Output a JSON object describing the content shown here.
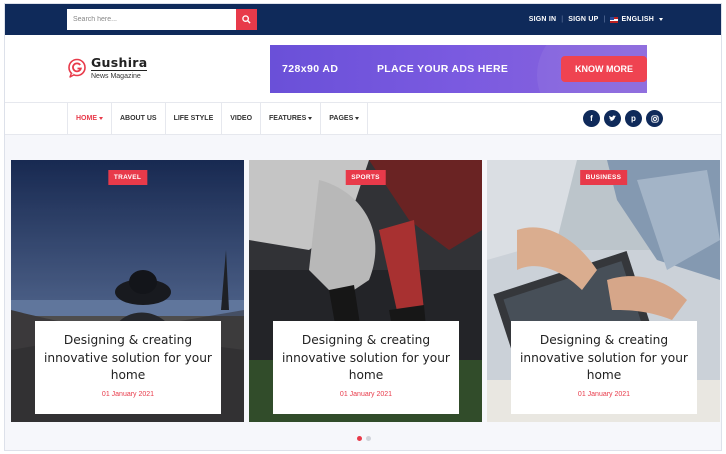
{
  "topbar": {
    "search_placeholder": "Search here...",
    "sign_in": "SIGN IN",
    "sign_up": "SIGN UP",
    "language": "ENGLISH"
  },
  "header": {
    "logo_name": "Gushira",
    "logo_tagline": "News Magazine",
    "ad_size": "728x90 AD",
    "ad_text": "PLACE YOUR ADS HERE",
    "ad_button": "KNOW MORE"
  },
  "nav": {
    "items": [
      {
        "label": "HOME",
        "dropdown": true,
        "active": true
      },
      {
        "label": "ABOUT US",
        "dropdown": false,
        "active": false
      },
      {
        "label": "LIFE STYLE",
        "dropdown": false,
        "active": false
      },
      {
        "label": "VIDEO",
        "dropdown": false,
        "active": false
      },
      {
        "label": "FEATURES",
        "dropdown": true,
        "active": false
      },
      {
        "label": "PAGES",
        "dropdown": true,
        "active": false
      }
    ],
    "social": [
      "facebook-icon",
      "twitter-icon",
      "pinterest-icon",
      "instagram-icon"
    ]
  },
  "slides": [
    {
      "category": "TRAVEL",
      "title": "Designing & creating innovative solution for your home",
      "date": "01 January 2021"
    },
    {
      "category": "SPORTS",
      "title": "Designing & creating innovative solution for your home",
      "date": "01 January 2021"
    },
    {
      "category": "BUSINESS",
      "title": "Designing & creating innovative solution for your home",
      "date": "01 January 2021"
    }
  ],
  "pagination": {
    "total": 2,
    "active": 0
  },
  "colors": {
    "navy": "#0f2a5a",
    "accent": "#e83a4a",
    "ad_purple": "#7a5ae0"
  }
}
